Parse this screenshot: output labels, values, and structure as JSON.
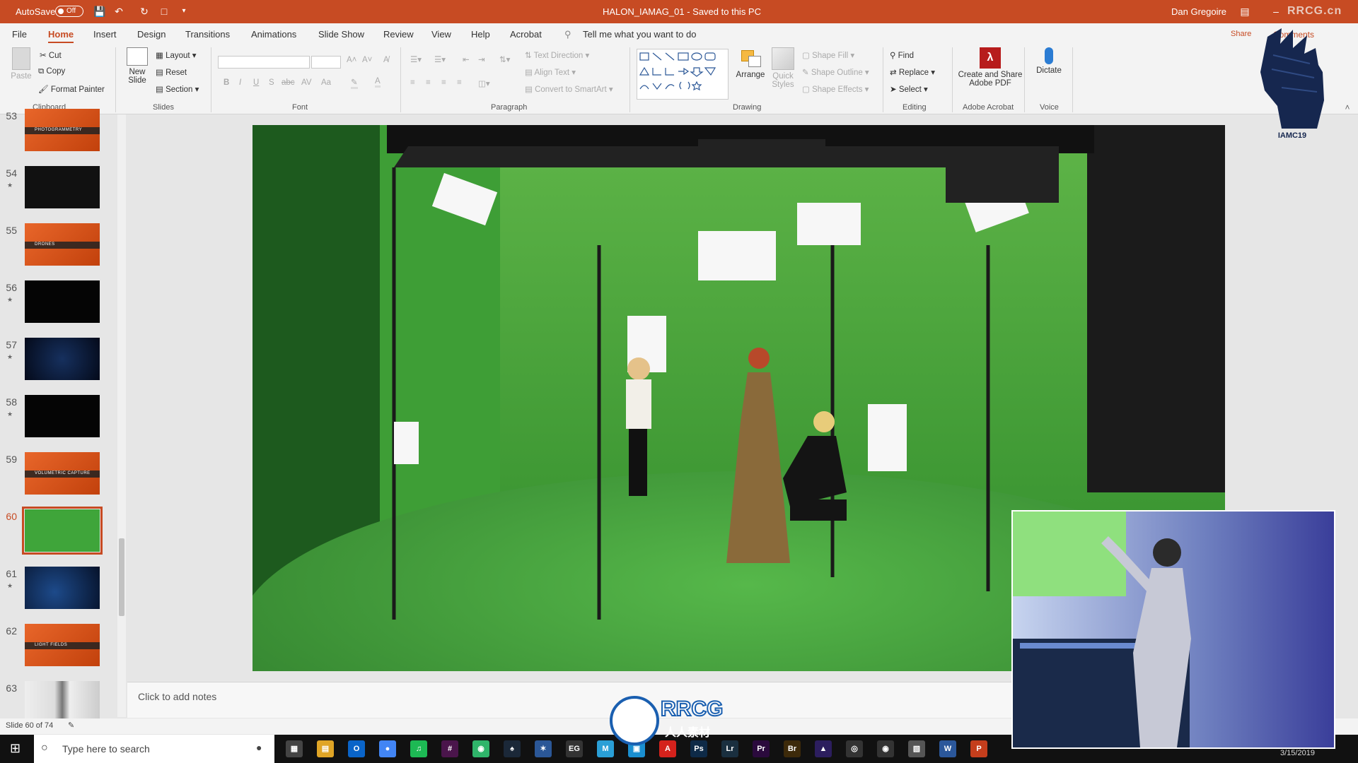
{
  "titlebar": {
    "autosave_label": "AutoSave",
    "autosave_state": "Off",
    "doc_title": "HALON_IAMAG_01  -  Saved to this PC",
    "user": "Dan Gregoire",
    "watermark": "RRCG.cn",
    "color": "#c74b23"
  },
  "menu": {
    "tabs": [
      "File",
      "Home",
      "Insert",
      "Design",
      "Transitions",
      "Animations",
      "Slide Show",
      "Review",
      "View",
      "Help",
      "Acrobat"
    ],
    "active": "Home",
    "search": "Tell me what you want to do",
    "share": "Share",
    "comments": "Comments"
  },
  "ribbon": {
    "clipboard": {
      "paste": "Paste",
      "cut": "Cut",
      "copy": "Copy",
      "format_painter": "Format Painter",
      "label": "Clipboard"
    },
    "slides": {
      "new_slide": "New Slide",
      "layout": "Layout",
      "reset": "Reset",
      "section": "Section",
      "label": "Slides"
    },
    "font": {
      "label": "Font",
      "bold": "B",
      "italic": "I",
      "underline": "U",
      "strike": "S",
      "shadow": "abc",
      "case": "Aa",
      "grow": "A˄",
      "shrink": "A˅"
    },
    "paragraph": {
      "label": "Paragraph",
      "text_direction": "Text Direction",
      "align_text": "Align Text",
      "smartart": "Convert to SmartArt"
    },
    "drawing": {
      "label": "Drawing",
      "arrange": "Arrange",
      "quick_styles": "Quick Styles",
      "shape_fill": "Shape Fill",
      "shape_outline": "Shape Outline",
      "shape_effects": "Shape Effects"
    },
    "editing": {
      "label": "Editing",
      "find": "Find",
      "replace": "Replace",
      "select": "Select"
    },
    "acrobat": {
      "label": "Adobe Acrobat",
      "create": "Create and Share Adobe PDF"
    },
    "voice": {
      "label": "Voice",
      "dictate": "Dictate"
    }
  },
  "logo": {
    "caption": "IAMC19"
  },
  "thumbnails": [
    {
      "num": "53",
      "kind": "orange",
      "star": false,
      "text": "PHOTOGRAMMETRY"
    },
    {
      "num": "54",
      "kind": "dark",
      "star": true
    },
    {
      "num": "55",
      "kind": "orange",
      "star": false,
      "text": "DRONES"
    },
    {
      "num": "56",
      "kind": "black",
      "star": true
    },
    {
      "num": "57",
      "kind": "navy",
      "star": true
    },
    {
      "num": "58",
      "kind": "black",
      "star": true
    },
    {
      "num": "59",
      "kind": "orange",
      "star": false,
      "text": "VOLUMETRIC CAPTURE"
    },
    {
      "num": "60",
      "kind": "green",
      "star": false,
      "selected": true
    },
    {
      "num": "61",
      "kind": "blue",
      "star": true
    },
    {
      "num": "62",
      "kind": "orange",
      "star": false,
      "text": "LIGHT FIELDS"
    },
    {
      "num": "63",
      "kind": "photo",
      "star": false
    }
  ],
  "notes": {
    "placeholder": "Click to add notes"
  },
  "status": {
    "slide_count": "Slide 60 of 74"
  },
  "taskbar": {
    "search_placeholder": "Type here to search",
    "date": "3/15/2019",
    "apps": [
      {
        "label": "▦",
        "color": "#444"
      },
      {
        "label": "▤",
        "color": "#e0a526"
      },
      {
        "label": "O",
        "color": "#0a64c8"
      },
      {
        "label": "●",
        "color": "#4285f4"
      },
      {
        "label": "♫",
        "color": "#1db954"
      },
      {
        "label": "#",
        "color": "#4a154b"
      },
      {
        "label": "◉",
        "color": "#2fb46a"
      },
      {
        "label": "♠",
        "color": "#1b2838"
      },
      {
        "label": "✶",
        "color": "#2b5797"
      },
      {
        "label": "EG",
        "color": "#333"
      },
      {
        "label": "M",
        "color": "#2a9fd6"
      },
      {
        "label": "▣",
        "color": "#1a8fd0"
      },
      {
        "label": "A",
        "color": "#d4221c"
      },
      {
        "label": "Ps",
        "color": "#0e2a47"
      },
      {
        "label": "Lr",
        "color": "#1a2f3f"
      },
      {
        "label": "Pr",
        "color": "#2b0a3d"
      },
      {
        "label": "Br",
        "color": "#3d2a0a"
      },
      {
        "label": "▲",
        "color": "#2c1e5e"
      },
      {
        "label": "◎",
        "color": "#333"
      },
      {
        "label": "◉",
        "color": "#333"
      },
      {
        "label": "▧",
        "color": "#555"
      },
      {
        "label": "W",
        "color": "#2b579a"
      },
      {
        "label": "P",
        "color": "#c43e1c"
      }
    ]
  },
  "overlay": {
    "brand": "RRCG",
    "brand_sub": "人人素材"
  }
}
